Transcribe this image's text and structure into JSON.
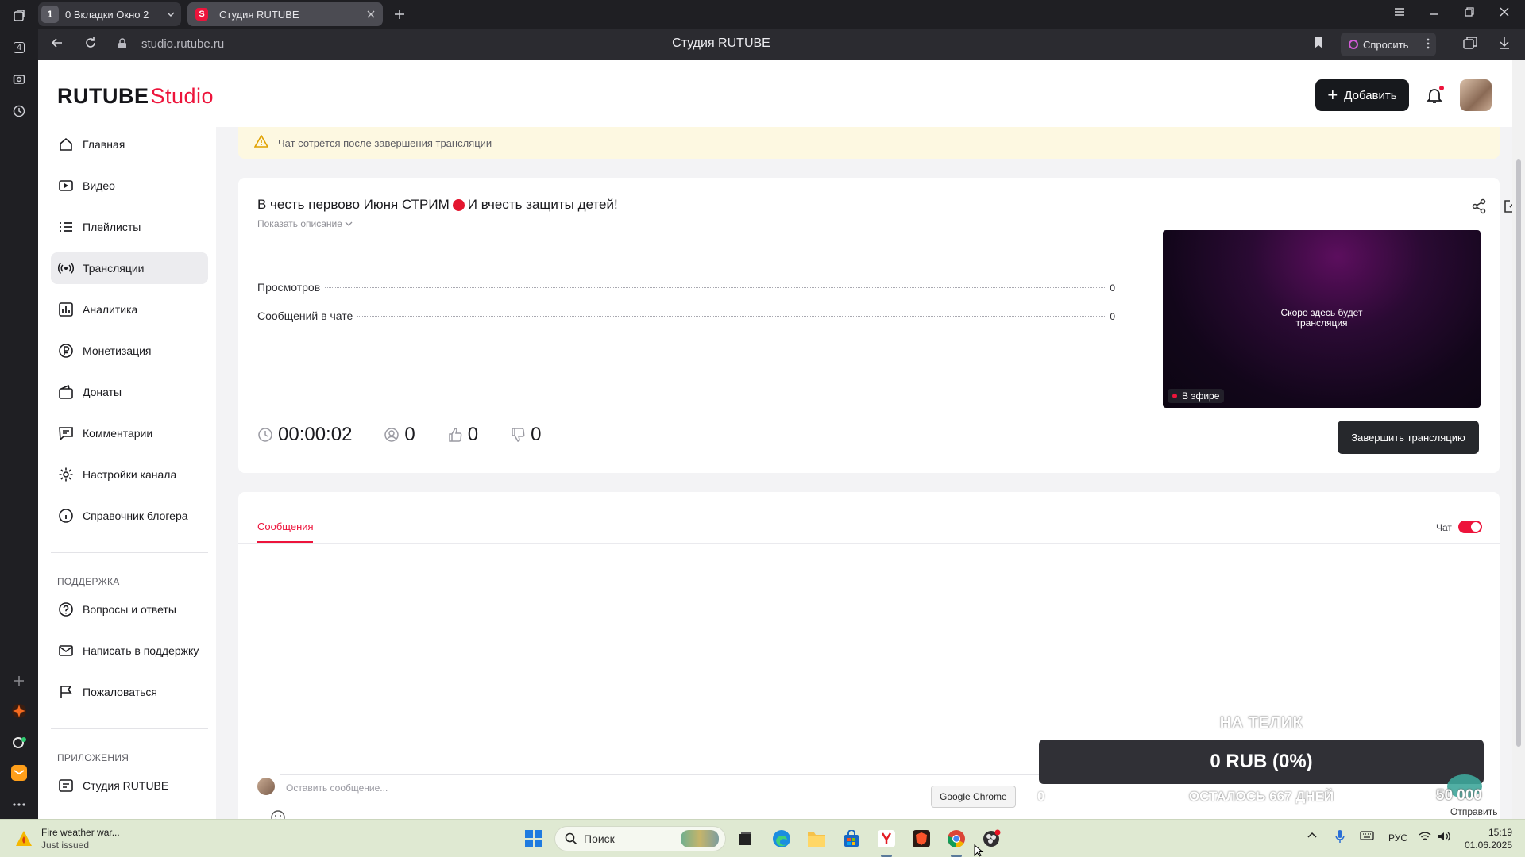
{
  "browser": {
    "tab_group_number": "1",
    "tab_group_label": "0  Вкладки Окно 2",
    "active_tab_title": "Студия RUTUBE",
    "active_tab_favicon": "S",
    "address_url": "studio.rutube.ru",
    "page_title": "Студия RUTUBE",
    "ask_label": "Спросить",
    "left_panel_badge": "4"
  },
  "header": {
    "logo_main": "RUTUBE",
    "logo_studio": "Studio",
    "add_label": "Добавить"
  },
  "sidebar": {
    "items": [
      {
        "label": "Главная",
        "icon": "home-icon"
      },
      {
        "label": "Видео",
        "icon": "video-icon"
      },
      {
        "label": "Плейлисты",
        "icon": "playlist-icon"
      },
      {
        "label": "Трансляции",
        "icon": "broadcast-icon",
        "active": true
      },
      {
        "label": "Аналитика",
        "icon": "analytics-icon"
      },
      {
        "label": "Монетизация",
        "icon": "monetization-icon"
      },
      {
        "label": "Донаты",
        "icon": "wallet-icon"
      },
      {
        "label": "Комментарии",
        "icon": "comment-icon"
      },
      {
        "label": "Настройки канала",
        "icon": "gear-icon"
      },
      {
        "label": "Справочник блогера",
        "icon": "info-icon"
      }
    ],
    "support_heading": "ПОДДЕРЖКА",
    "support_items": [
      {
        "label": "Вопросы и ответы",
        "icon": "question-icon"
      },
      {
        "label": "Написать в поддержку",
        "icon": "mail-icon"
      },
      {
        "label": "Пожаловаться",
        "icon": "flag-icon"
      }
    ],
    "apps_heading": "ПРИЛОЖЕНИЯ",
    "apps_items": [
      {
        "label": "Студия RUTUBE",
        "icon": "studio-icon"
      }
    ]
  },
  "main": {
    "warning_text": "Чат сотрётся после завершения трансляции",
    "stream": {
      "title_part1": "В честь первово Июня СТРИМ",
      "title_part2": "И вчесть защиты детей!",
      "show_description": "Показать описание",
      "stats": [
        {
          "label": "Просмотров",
          "value": "0"
        },
        {
          "label": "Сообщений в чате",
          "value": "0"
        }
      ],
      "duration": "00:00:02",
      "viewers": "0",
      "likes": "0",
      "dislikes": "0",
      "preview_text_line1": "Скоро здесь будет",
      "preview_text_line2": "трансляция",
      "live_label": "В эфире",
      "end_button": "Завершить трансляцию"
    },
    "chat": {
      "tab_messages": "Сообщения",
      "toggle_label": "Чат",
      "toggle_on": true,
      "input_placeholder": "Оставить сообщение...",
      "send_label": "Отправить"
    }
  },
  "overlay": {
    "title": "НА ТЕЛИК",
    "amount": "0 RUB (0%)",
    "left_value": "0",
    "days_left": "ОСТАЛОСЬ 667 ДНЕЙ",
    "goal": "50 000"
  },
  "tooltip": "Google Chrome",
  "taskbar": {
    "weather_title": "Fire weather war...",
    "weather_sub": "Just issued",
    "search_label": "Поиск",
    "language": "РУС",
    "time": "15:19",
    "date": "01.06.2025"
  },
  "colors": {
    "accent": "#ed143b",
    "dark_button": "#17191d",
    "warning_bg": "#fdf8e1"
  }
}
